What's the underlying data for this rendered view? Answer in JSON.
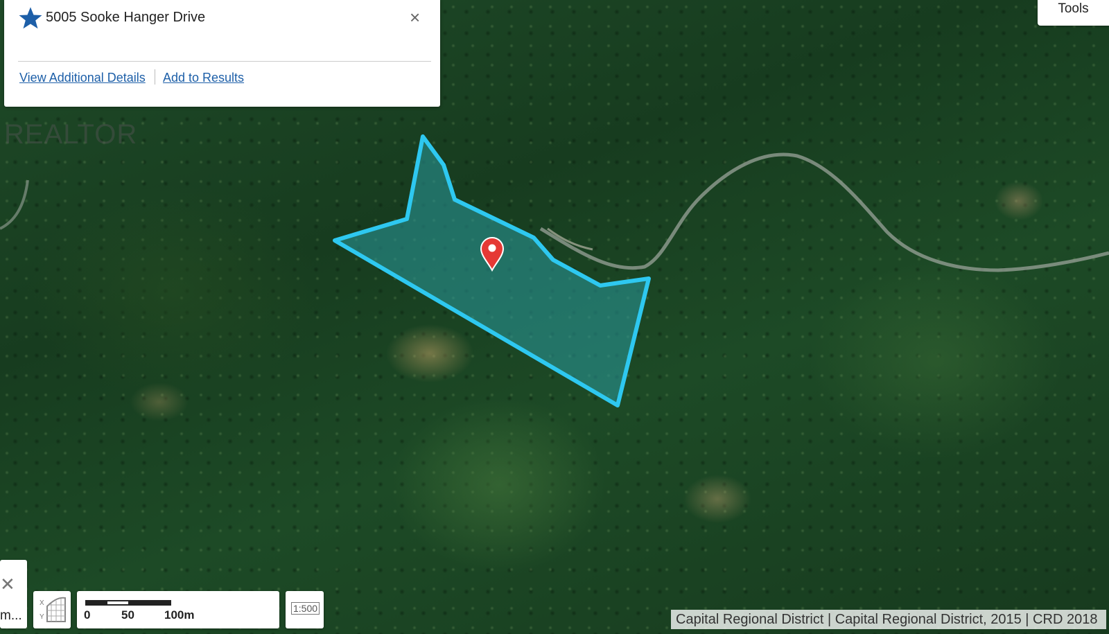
{
  "popup": {
    "title": "5005 Sooke Hanger Drive",
    "star_icon": "star-icon",
    "close_glyph": "×",
    "link_details": "View Additional Details",
    "link_add": "Add to Results"
  },
  "watermark": {
    "text": "REALTOR"
  },
  "tools": {
    "label": "Tools"
  },
  "left_control": {
    "label": "m..."
  },
  "scale": {
    "label_0": "0",
    "label_50": "50",
    "label_100": "100m"
  },
  "ratio": {
    "label": "1:500"
  },
  "attribution": "Capital Regional District | Capital Regional District, 2015 | CRD 2018",
  "colors": {
    "parcel_outline": "#2ec8f0",
    "parcel_fill": "#2a9a9e",
    "marker": "#e53935",
    "link": "#1d5fa8"
  }
}
